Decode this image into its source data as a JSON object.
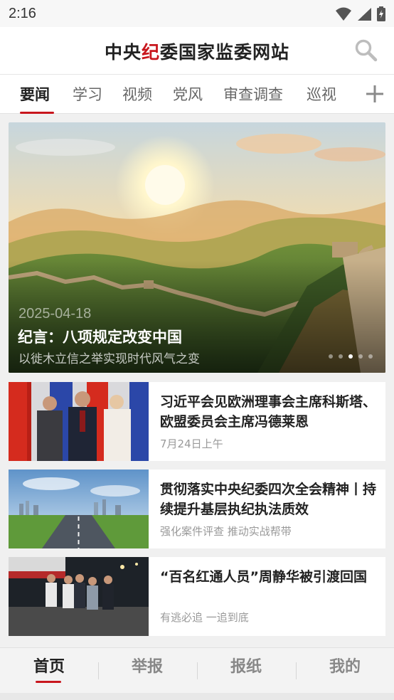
{
  "status": {
    "time": "2:16"
  },
  "header": {
    "title_part1": "中央",
    "title_accent": "纪",
    "title_part2": "委国家监委网站"
  },
  "tabs": [
    {
      "label": "要闻",
      "active": true
    },
    {
      "label": "学习"
    },
    {
      "label": "视频"
    },
    {
      "label": "党风"
    },
    {
      "label": "审查调查"
    },
    {
      "label": "巡视"
    }
  ],
  "hero": {
    "date": "2025-04-18",
    "title": "纪言：八项规定改变中国",
    "subtitle": "以徙木立信之举实现时代风气之变",
    "slide_count": 5,
    "active_slide": 3
  },
  "news": [
    {
      "title": "习近平会见欧洲理事会主席科斯塔、欧盟委员会主席冯德莱恩",
      "meta": "7月24日上午"
    },
    {
      "title": "贯彻落实中央纪委四次全会精神丨持续提升基层执纪执法质效",
      "meta": "强化案件评查 推动实战帮带"
    },
    {
      "title": "“百名红通人员”周静华被引渡回国",
      "meta": "有逃必追 一追到底"
    }
  ],
  "bottom_nav": [
    {
      "label": "首页",
      "active": true
    },
    {
      "label": "举报"
    },
    {
      "label": "报纸"
    },
    {
      "label": "我的"
    }
  ],
  "colors": {
    "accent": "#c8161d"
  },
  "icons": [
    "wifi-icon",
    "signal-icon",
    "battery-icon",
    "search-icon",
    "add-tab-icon"
  ]
}
